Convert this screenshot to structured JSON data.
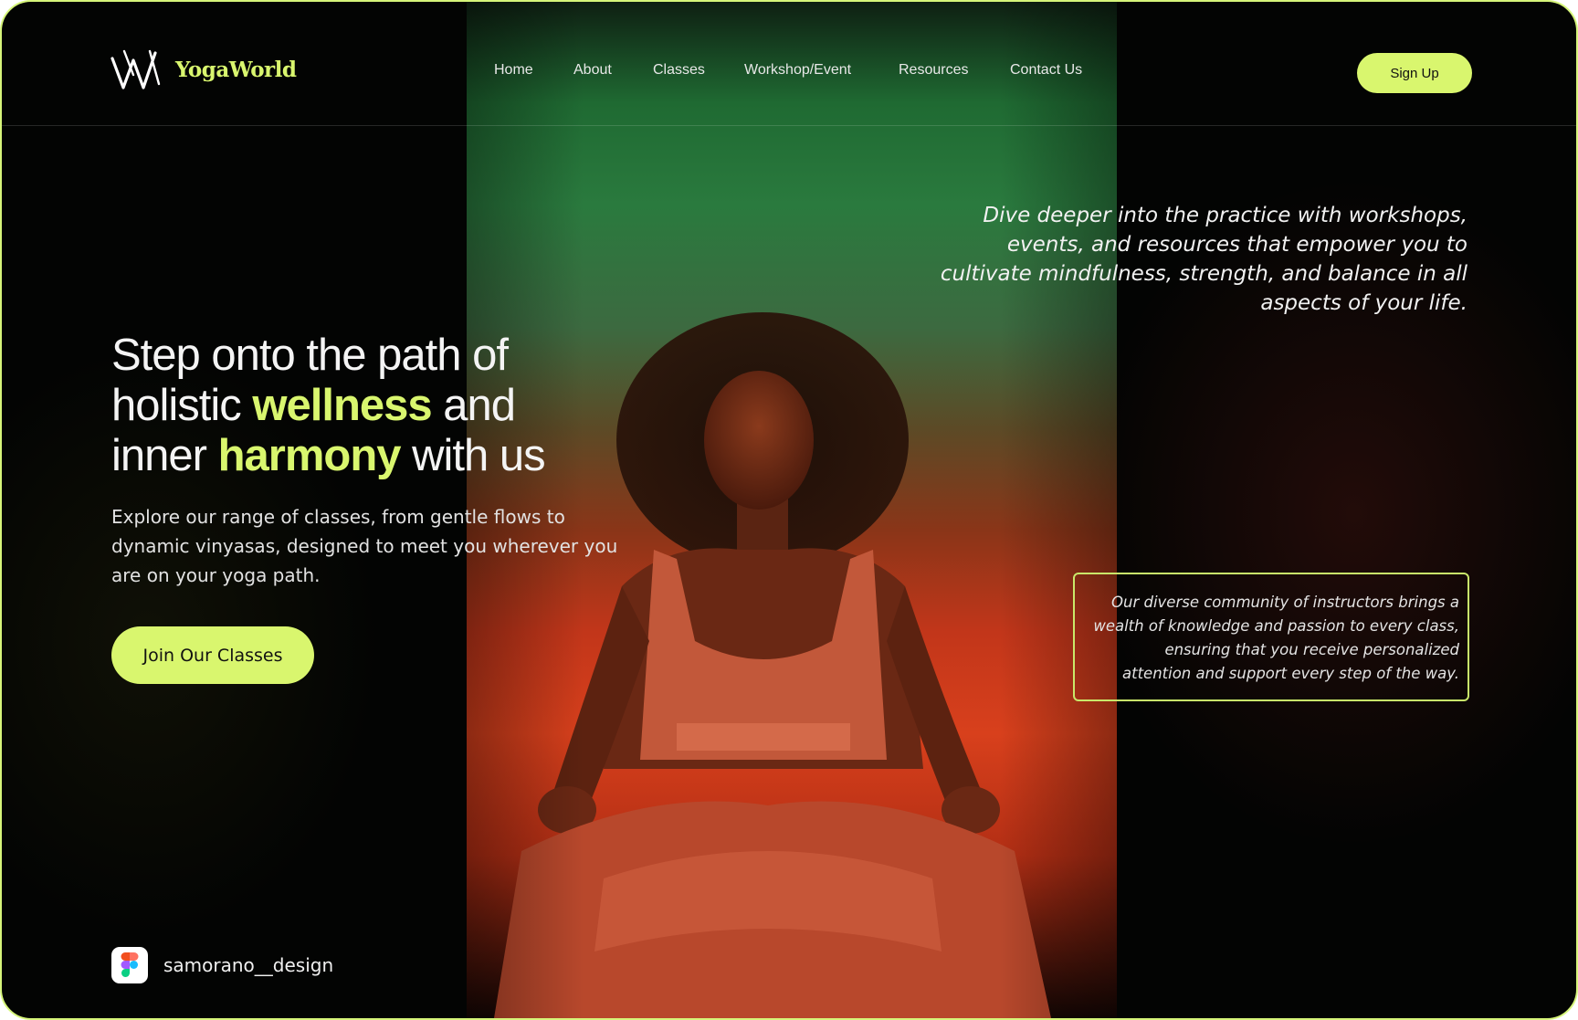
{
  "brand": {
    "name": "YogaWorld",
    "accent": "#d9f66e",
    "background": "#030403",
    "logo_icon": "yogaworld-logo-icon"
  },
  "nav": {
    "items": [
      "Home",
      "About",
      "Classes",
      "Workshop/Event",
      "Resources",
      "Contact Us"
    ],
    "signup_label": "Sign Up"
  },
  "hero": {
    "headline": {
      "line1": "Step onto the path of",
      "line2_before": "holistic ",
      "line2_highlight": "wellness",
      "line2_after": " and",
      "line3_before": "inner ",
      "line3_highlight": "harmony",
      "line3_after": " with us"
    },
    "subtext": "Explore our range of classes, from gentle flows to dynamic vinyasas, designed to meet you wherever you are on your yoga path.",
    "cta_label": "Join Our Classes",
    "image_subject": "woman-meditating-photo"
  },
  "quote": "Dive deeper into the practice with workshops, events, and resources that empower you to cultivate mindfulness, strength, and balance in all aspects of your life.",
  "community_card": "Our diverse community of instructors brings a wealth of knowledge and passion to every class, ensuring that you receive personalized attention and support every step of the way.",
  "credit": {
    "handle": "samorano__design",
    "icon": "figma-icon"
  }
}
